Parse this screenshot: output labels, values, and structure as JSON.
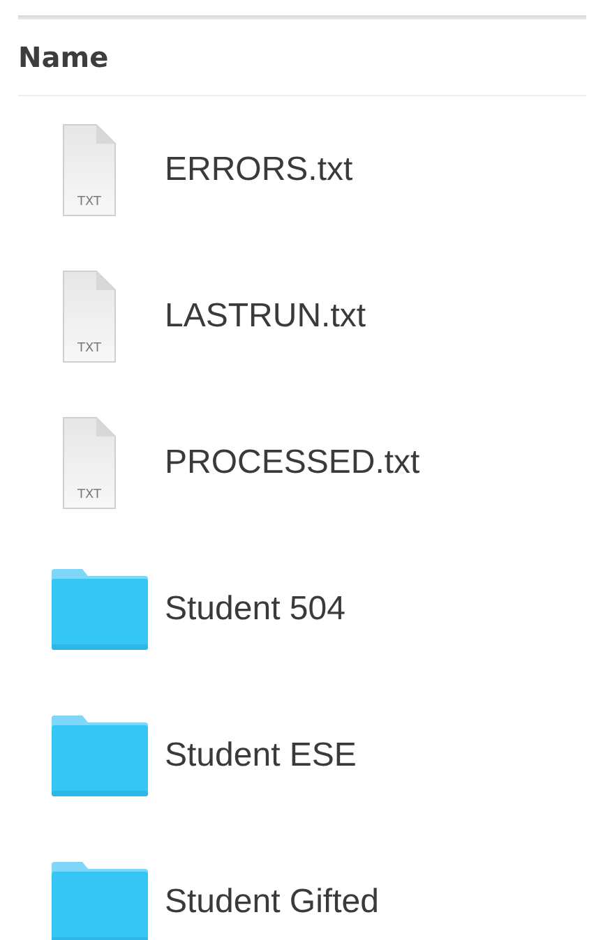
{
  "header": {
    "column_1": "Name"
  },
  "files": [
    {
      "kind": "text",
      "name": "ERRORS.txt",
      "icon_label": "TXT"
    },
    {
      "kind": "text",
      "name": "LASTRUN.txt",
      "icon_label": "TXT"
    },
    {
      "kind": "text",
      "name": "PROCESSED.txt",
      "icon_label": "TXT"
    },
    {
      "kind": "folder",
      "name": "Student 504"
    },
    {
      "kind": "folder",
      "name": "Student ESE"
    },
    {
      "kind": "folder",
      "name": "Student Gifted"
    }
  ]
}
